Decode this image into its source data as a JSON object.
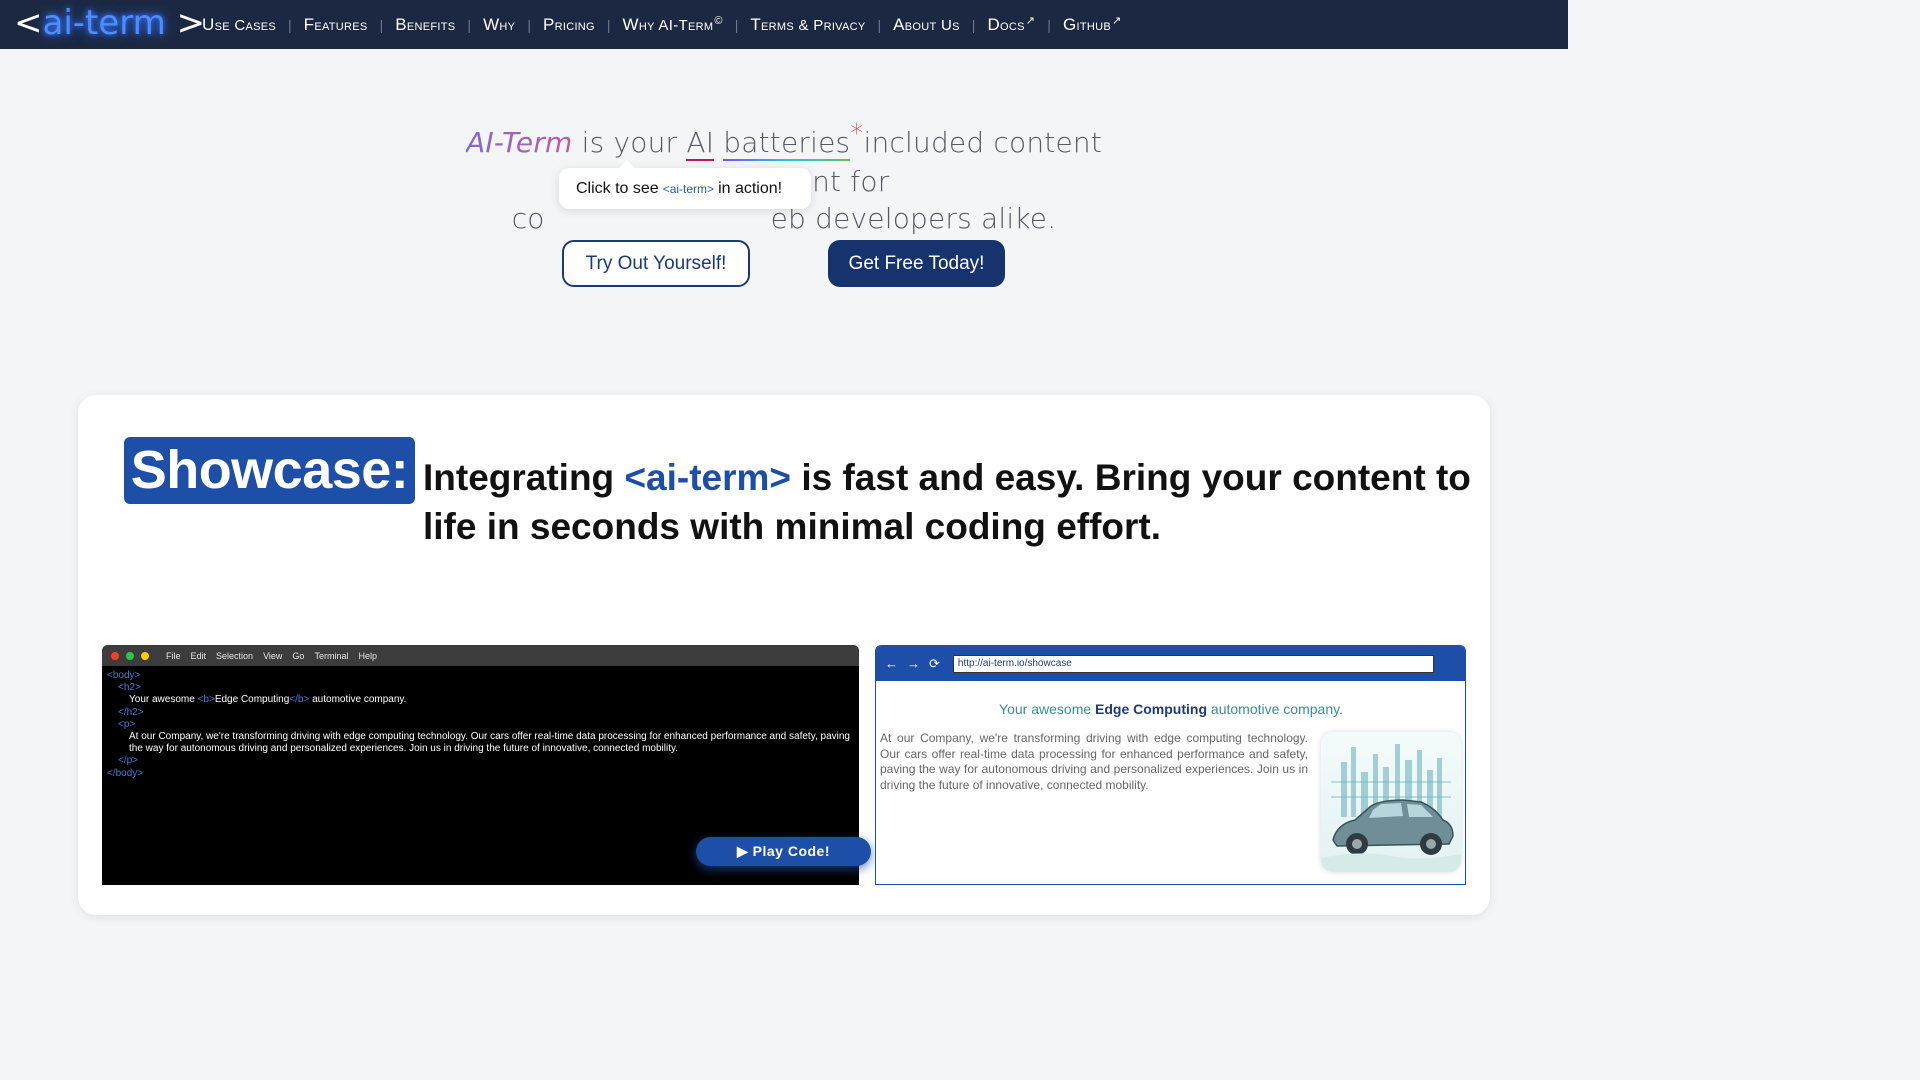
{
  "nav": {
    "logo_bracket_open": "<",
    "logo_name": "ai-term",
    "logo_bracket_close": ">",
    "items": [
      {
        "first": "U",
        "rest": "se Cases",
        "sup": ""
      },
      {
        "first": "F",
        "rest": "eatures",
        "sup": ""
      },
      {
        "first": "B",
        "rest": "enefits",
        "sup": ""
      },
      {
        "first": "W",
        "rest": "hy",
        "sup": ""
      },
      {
        "first": "P",
        "rest": "ricing",
        "sup": ""
      },
      {
        "first": "W",
        "rest": "hy AI-Term",
        "sup": "©"
      },
      {
        "first": "T",
        "rest": "erms & Privacy",
        "sup": ""
      },
      {
        "first": "A",
        "rest": "bout Us",
        "sup": ""
      },
      {
        "first": "D",
        "rest": "ocs",
        "sup": "↗"
      },
      {
        "first": "G",
        "rest": "ithub",
        "sup": "↗"
      }
    ]
  },
  "hero": {
    "brand": "AI-Term",
    "t1": " is your ",
    "ai": "AI",
    "sp": " ",
    "batteries": "batteries",
    "star": "*",
    "t2": "included content enrichment for",
    "line2_start": "co",
    "line2_end": "eb developers alike.",
    "tooltip_pre": "Click to see",
    "tooltip_code": "<ai-term>",
    "tooltip_post": "in action!",
    "try_button": "Try Out Yourself!",
    "get_button": "Get Free Today!"
  },
  "showcase": {
    "badge": "Showcase:",
    "h1": "Integrating ",
    "h_hl": "<ai-term>",
    "h2": " is fast and easy. Bring your content to life in seconds with minimal coding effort."
  },
  "editor": {
    "dot_colors": [
      "#ff3b30",
      "#28c840",
      "#ffcc00"
    ],
    "menu": [
      "File",
      "Edit",
      "Selection",
      "View",
      "Go",
      "Terminal",
      "Help"
    ],
    "body_open": "<body>",
    "h2_open": "<h2>",
    "h2_text_1": "Your awesome ",
    "b_open": "<b>",
    "b_text": "Edge Computing",
    "b_close": "</b>",
    "h2_text_2": " automotive company.",
    "h2_close": "</h2>",
    "p_open": "<p>",
    "p_text": "At our Company, we're transforming driving with edge computing technology. Our cars offer real-time data processing for enhanced performance and safety, paving the way for autonomous driving and personalized experiences. Join us in driving the future of innovative, connected mobility.",
    "p_close": "</p>",
    "body_close": "</body>",
    "play_label": "▶ Play Code!"
  },
  "browser": {
    "back": "←",
    "forward": "→",
    "reload": "⟳",
    "url": "http://ai-term.io/showcase",
    "title_1": "Your awesome ",
    "title_b": "Edge Computing",
    "title_2": " automotive company.",
    "body": "At our Company, we're transforming driving with edge computing technology. Our cars offer real-time data processing for enhanced performance and safety, paving the way for autonomous driving and personalized experiences. Join us in driving the future of innovative, connected mobility."
  }
}
